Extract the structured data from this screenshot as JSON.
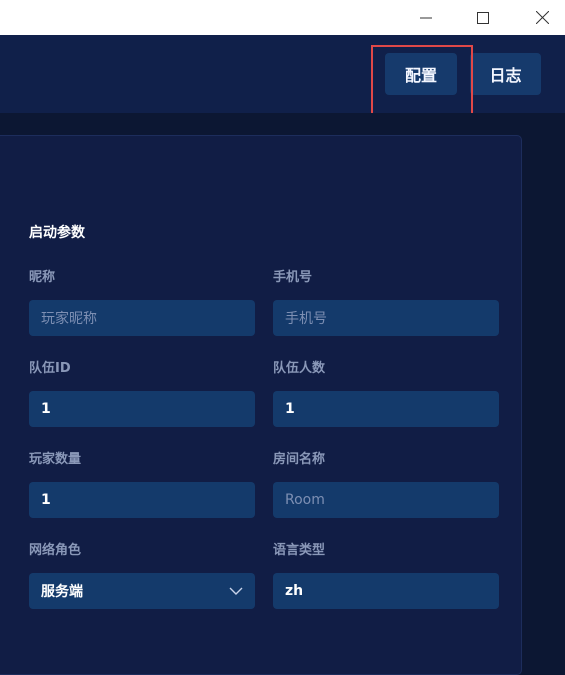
{
  "window": {
    "controls": [
      "minimize-icon",
      "maximize-icon",
      "close-icon"
    ]
  },
  "toolbar": {
    "config_label": "配置",
    "log_label": "日志"
  },
  "form": {
    "section_title": "启动参数",
    "fields": {
      "nickname": {
        "label": "昵称",
        "placeholder": "玩家昵称",
        "value": ""
      },
      "phone": {
        "label": "手机号",
        "placeholder": "手机号",
        "value": ""
      },
      "team_id": {
        "label": "队伍ID",
        "value": "1"
      },
      "team_size": {
        "label": "队伍人数",
        "value": "1"
      },
      "player_count": {
        "label": "玩家数量",
        "value": "1"
      },
      "room_name": {
        "label": "房间名称",
        "placeholder": "Room",
        "value": ""
      },
      "network_role": {
        "label": "网络角色",
        "value": "服务端",
        "icon": "chevron-down-icon"
      },
      "language": {
        "label": "语言类型",
        "value": "zh"
      }
    }
  },
  "colors": {
    "background": "#0c1733",
    "topbar": "#10204a",
    "card": "#111d45",
    "input": "#143a6b",
    "button": "#163a6c",
    "highlight": "#e04848"
  }
}
